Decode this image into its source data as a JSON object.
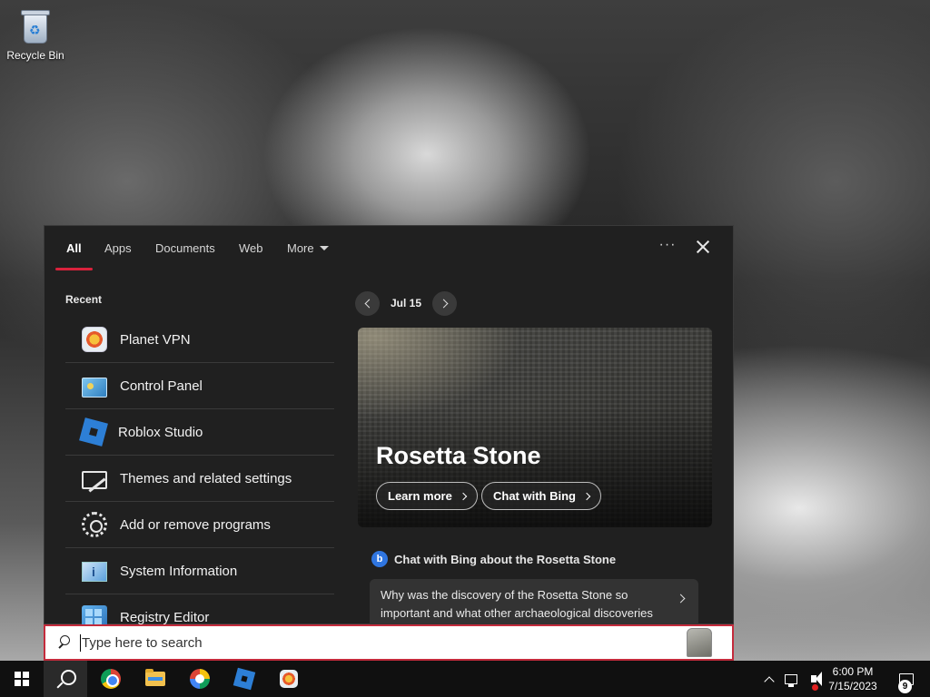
{
  "desktop": {
    "icons": [
      {
        "label": "Recycle Bin",
        "icon": "recycle-bin-icon"
      }
    ]
  },
  "search_panel": {
    "tabs": [
      {
        "label": "All",
        "active": true
      },
      {
        "label": "Apps",
        "active": false
      },
      {
        "label": "Documents",
        "active": false
      },
      {
        "label": "Web",
        "active": false
      },
      {
        "label": "More",
        "active": false
      }
    ],
    "more_options_label": "···",
    "accent_color": "#d9223c",
    "recent": {
      "heading": "Recent",
      "items": [
        {
          "label": "Planet VPN",
          "icon": "planet-vpn-icon"
        },
        {
          "label": "Control Panel",
          "icon": "control-panel-icon"
        },
        {
          "label": "Roblox Studio",
          "icon": "roblox-studio-icon"
        },
        {
          "label": "Themes and related settings",
          "icon": "themes-icon"
        },
        {
          "label": "Add or remove programs",
          "icon": "gear-icon"
        },
        {
          "label": "System Information",
          "icon": "system-information-icon"
        },
        {
          "label": "Registry Editor",
          "icon": "registry-editor-icon"
        }
      ]
    },
    "highlight": {
      "date": "Jul 15",
      "title": "Rosetta Stone",
      "learn_more": "Learn more",
      "chat_with_bing": "Chat with Bing",
      "chat_prompt_heading": "Chat with Bing about the Rosetta Stone",
      "question": "Why was the discovery of the Rosetta Stone so important and what other archaeological discoveries have had a similar impact?"
    }
  },
  "searchbar": {
    "placeholder": "Type here to search"
  },
  "taskbar": {
    "pinned": [
      {
        "name": "start-button",
        "icon": "windows-logo-icon"
      },
      {
        "name": "search-button",
        "icon": "search-icon"
      },
      {
        "name": "chrome-button",
        "icon": "chrome-icon"
      },
      {
        "name": "file-explorer-button",
        "icon": "folder-icon"
      },
      {
        "name": "camera-app-button",
        "icon": "camera-icon"
      },
      {
        "name": "roblox-studio-button",
        "icon": "roblox-icon"
      },
      {
        "name": "planet-vpn-button",
        "icon": "planet-vpn-icon"
      }
    ],
    "clock": {
      "time": "6:00 PM",
      "date": "7/15/2023"
    },
    "notification_count": "9"
  }
}
